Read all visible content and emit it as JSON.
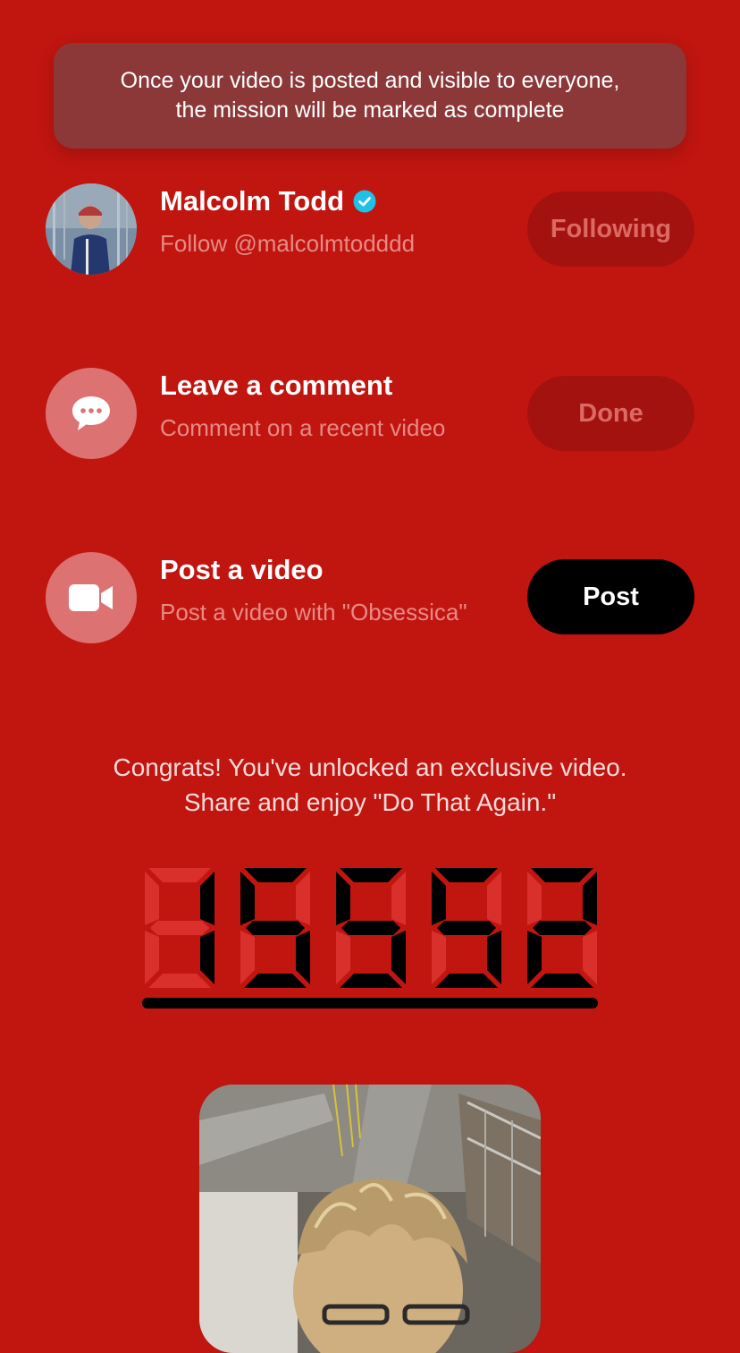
{
  "toast": {
    "message": "Once your video is posted and visible to everyone,\nthe mission will be marked as complete"
  },
  "tasks": [
    {
      "title": "Malcolm Todd",
      "subtitle": "Follow @malcolmtodddd",
      "button": "Following",
      "icon": "avatar-image",
      "verified_icon": "verified-check-icon",
      "state": "done"
    },
    {
      "title": "Leave a comment",
      "subtitle": "Comment on a recent video",
      "button": "Done",
      "icon": "comment-bubble-icon",
      "state": "done"
    },
    {
      "title": "Post a video",
      "subtitle": "Post a video with \"Obsessica\"",
      "button": "Post",
      "icon": "video-camera-icon",
      "state": "active"
    }
  ],
  "congrats": {
    "message": "Congrats! You've unlocked an exclusive video.\nShare and enjoy \"Do That Again.\""
  },
  "counter": {
    "value": "15552",
    "display": "seven-segment"
  },
  "colors": {
    "background": "#c11510",
    "toast": "#8c3838",
    "muted_button": "#a3120f",
    "active_button": "#000000",
    "verified": "#20c1e6"
  }
}
